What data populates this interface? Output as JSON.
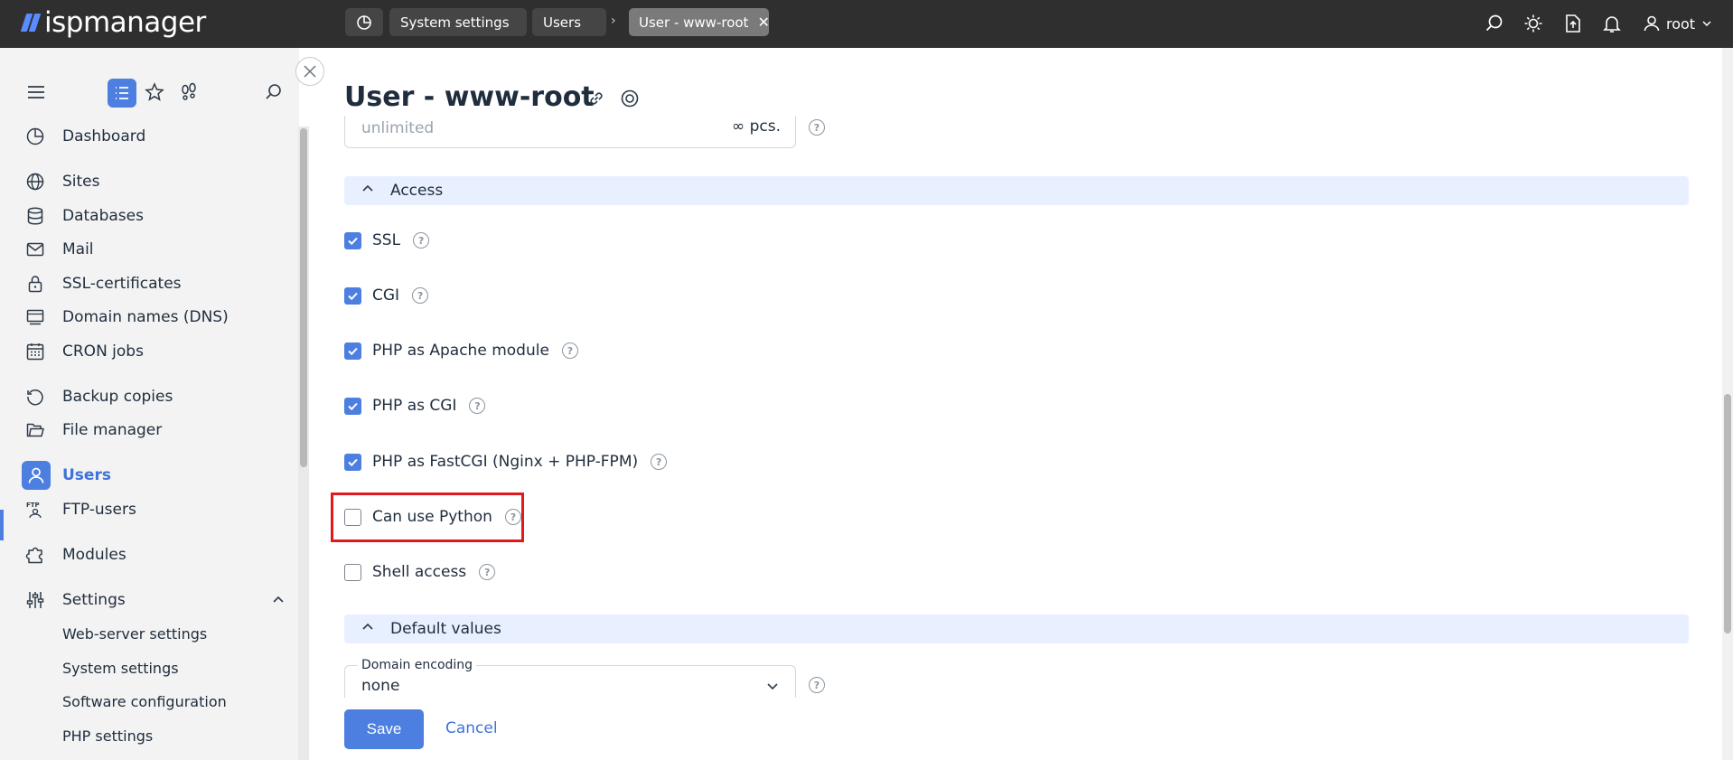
{
  "app": {
    "logo_text": "ispmanager"
  },
  "breadcrumbs": {
    "items": [
      "System settings",
      "Users"
    ],
    "separator": "›",
    "active": "User - www-root",
    "close_glyph": "✕"
  },
  "header": {
    "user_name": "root"
  },
  "sidebar": {
    "items": [
      {
        "label": "Dashboard",
        "icon": "dashboard-icon"
      },
      {
        "label": "Sites",
        "icon": "globe-icon"
      },
      {
        "label": "Databases",
        "icon": "database-icon"
      },
      {
        "label": "Mail",
        "icon": "mail-icon"
      },
      {
        "label": "SSL-certificates",
        "icon": "lock-icon"
      },
      {
        "label": "Domain names (DNS)",
        "icon": "dns-icon"
      },
      {
        "label": "CRON jobs",
        "icon": "calendar-icon"
      },
      {
        "label": "Backup copies",
        "icon": "backup-icon"
      },
      {
        "label": "File manager",
        "icon": "folder-icon"
      },
      {
        "label": "Users",
        "icon": "user-icon",
        "active": true
      },
      {
        "label": "FTP-users",
        "icon": "ftp-icon"
      },
      {
        "label": "Modules",
        "icon": "puzzle-icon"
      },
      {
        "label": "Settings",
        "icon": "sliders-icon",
        "expanded": true
      }
    ],
    "settings_subitems": [
      "Web-server settings",
      "System settings",
      "Software configuration",
      "PHP settings"
    ]
  },
  "page": {
    "title": "User - www-root",
    "top_field": {
      "value": "unlimited",
      "unit": "∞ pcs."
    },
    "sections": {
      "access": "Access",
      "defaults": "Default values"
    },
    "access_options": [
      {
        "label": "SSL",
        "checked": true
      },
      {
        "label": "CGI",
        "checked": true
      },
      {
        "label": "PHP as Apache module",
        "checked": true
      },
      {
        "label": "PHP as CGI",
        "checked": true
      },
      {
        "label": "PHP as FastCGI (Nginx + PHP-FPM)",
        "checked": true
      },
      {
        "label": "Can use Python",
        "checked": false,
        "highlighted": true
      },
      {
        "label": "Shell access",
        "checked": false
      }
    ],
    "domain_encoding": {
      "label": "Domain encoding",
      "value": "none"
    },
    "help_glyph": "?"
  },
  "actions": {
    "save": "Save",
    "cancel": "Cancel"
  },
  "colors": {
    "accent": "#4d7fe0",
    "topbar": "#2f2f2f",
    "highlight": "#e01a1a",
    "section_bg": "#e8efff"
  }
}
